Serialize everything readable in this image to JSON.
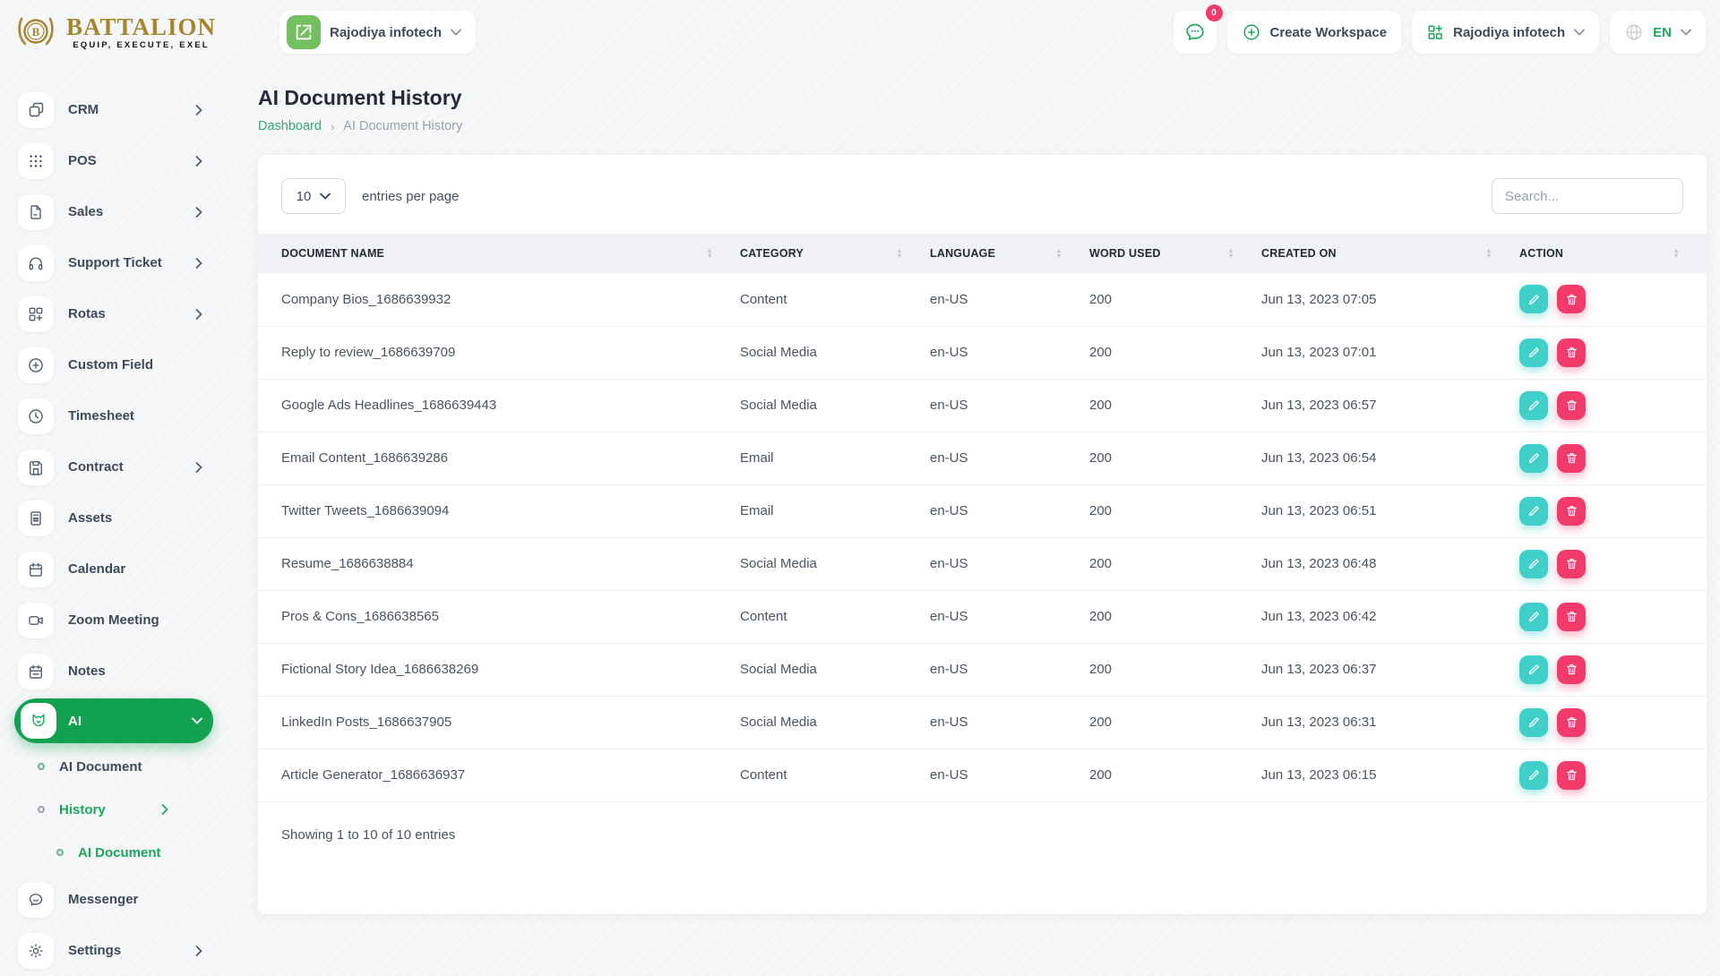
{
  "brand": {
    "name": "BATTALION",
    "tagline": "EQUIP, EXECUTE, EXEL",
    "monogram": "B"
  },
  "colors": {
    "accent_green": "#12a150",
    "edit_teal": "#41cfca",
    "delete_pink": "#f23a6b",
    "brand_gold": "#a5862e"
  },
  "topbar": {
    "workspace": "Rajodiya infotech",
    "chat_badge": "0",
    "create_workspace_label": "Create Workspace",
    "company": "Rajodiya infotech",
    "language": "EN"
  },
  "sidebar": {
    "items": [
      {
        "label": "CRM"
      },
      {
        "label": "POS"
      },
      {
        "label": "Sales"
      },
      {
        "label": "Support Ticket"
      },
      {
        "label": "Rotas"
      },
      {
        "label": "Custom Field"
      },
      {
        "label": "Timesheet"
      },
      {
        "label": "Contract"
      },
      {
        "label": "Assets"
      },
      {
        "label": "Calendar"
      },
      {
        "label": "Zoom Meeting"
      },
      {
        "label": "Notes"
      },
      {
        "label": "AI"
      },
      {
        "label": "AI Document"
      },
      {
        "label": "History"
      },
      {
        "label": "AI Document"
      },
      {
        "label": "Messenger"
      },
      {
        "label": "Settings"
      }
    ]
  },
  "page": {
    "title": "AI Document History"
  },
  "breadcrumb": {
    "home": "Dashboard",
    "current": "AI Document History"
  },
  "controls": {
    "page_size": "10",
    "entries_label": "entries per page",
    "search_placeholder": "Search..."
  },
  "table": {
    "headers": [
      "Document Name",
      "Category",
      "Language",
      "Word Used",
      "Created On",
      "Action"
    ],
    "rows": [
      {
        "name": "Company Bios_1686639932",
        "category": "Content",
        "language": "en-US",
        "words": "200",
        "created": "Jun 13, 2023 07:05"
      },
      {
        "name": "Reply to review_1686639709",
        "category": "Social Media",
        "language": "en-US",
        "words": "200",
        "created": "Jun 13, 2023 07:01"
      },
      {
        "name": "Google Ads Headlines_1686639443",
        "category": "Social Media",
        "language": "en-US",
        "words": "200",
        "created": "Jun 13, 2023 06:57"
      },
      {
        "name": "Email Content_1686639286",
        "category": "Email",
        "language": "en-US",
        "words": "200",
        "created": "Jun 13, 2023 06:54"
      },
      {
        "name": "Twitter Tweets_1686639094",
        "category": "Email",
        "language": "en-US",
        "words": "200",
        "created": "Jun 13, 2023 06:51"
      },
      {
        "name": "Resume_1686638884",
        "category": "Social Media",
        "language": "en-US",
        "words": "200",
        "created": "Jun 13, 2023 06:48"
      },
      {
        "name": "Pros & Cons_1686638565",
        "category": "Content",
        "language": "en-US",
        "words": "200",
        "created": "Jun 13, 2023 06:42"
      },
      {
        "name": "Fictional Story Idea_1686638269",
        "category": "Social Media",
        "language": "en-US",
        "words": "200",
        "created": "Jun 13, 2023 06:37"
      },
      {
        "name": "LinkedIn Posts_1686637905",
        "category": "Social Media",
        "language": "en-US",
        "words": "200",
        "created": "Jun 13, 2023 06:31"
      },
      {
        "name": "Article Generator_1686636937",
        "category": "Content",
        "language": "en-US",
        "words": "200",
        "created": "Jun 13, 2023 06:15"
      }
    ],
    "footer": "Showing 1 to 10 of 10 entries"
  }
}
